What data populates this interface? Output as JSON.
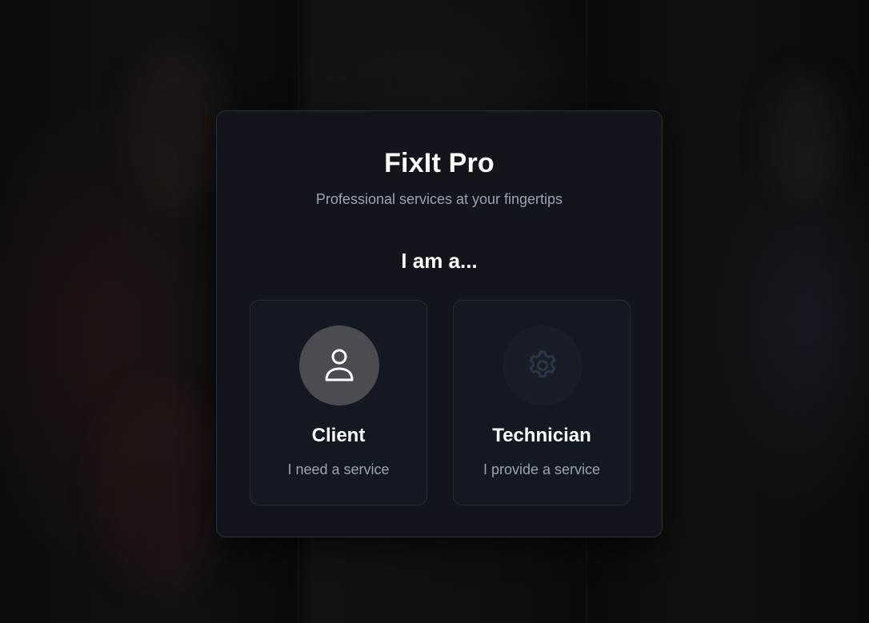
{
  "app": {
    "brand": "FixIt Pro",
    "tagline": "Professional services at your fingertips"
  },
  "role_select": {
    "prompt": "I am a...",
    "options": [
      {
        "title": "Client",
        "description": "I need a service",
        "icon": "user-icon",
        "selected": true
      },
      {
        "title": "Technician",
        "description": "I provide a service",
        "icon": "gear-icon",
        "selected": false
      }
    ]
  },
  "colors": {
    "card_background": "#13161d",
    "card_border": "#2a2f38",
    "text_primary": "#ffffff",
    "text_secondary": "#9aa3b2",
    "client_icon_bg": "#4a4c52",
    "technician_icon_bg": "#181d26",
    "technician_icon": "#2b3546"
  }
}
